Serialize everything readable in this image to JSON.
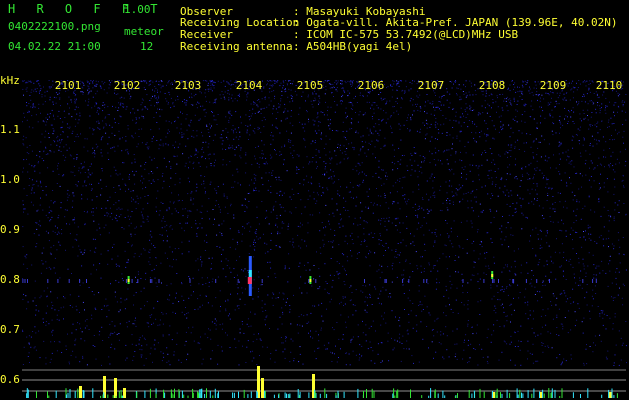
{
  "header": {
    "app_name": "H R O F F T",
    "version": "1.00",
    "filename": "0402222100.png",
    "datetime": "04.02.22 21:00",
    "meteor_label": "meteor",
    "meteor_count": "12",
    "info": [
      {
        "label": "Observer",
        "value": ": Masayuki Kobayashi"
      },
      {
        "label": "Receiving Location",
        "value": ": Ogata-vill. Akita-Pref. JAPAN (139.96E, 40.02N)"
      },
      {
        "label": "Receiver",
        "value": ": ICOM IC-575 53.7492(@LCD)MHz USB"
      },
      {
        "label": "Receiving antenna",
        "value": ": A504HB(yagi 4el)"
      }
    ]
  },
  "chart_data": {
    "type": "heatmap",
    "ylabel": "kHz",
    "x_ticks": [
      "2101",
      "2102",
      "2103",
      "2104",
      "2105",
      "2106",
      "2107",
      "2108",
      "2109",
      "2110"
    ],
    "y_ticks": [
      "1.1",
      "1.0",
      "0.9",
      "0.8",
      "0.7",
      "0.6"
    ],
    "meteor_pings": [
      {
        "x": "2104",
        "y": 0.8
      },
      {
        "x": "2102",
        "y": 0.8
      },
      {
        "x": "2105",
        "y": 0.8
      },
      {
        "x": "2108",
        "y": 0.81
      }
    ],
    "colors": {
      "background": "#000000",
      "noise": "#1a1aa8",
      "signal": "#ffff33",
      "peak": "#ff3366",
      "text": "#ffff33",
      "header": "#33e633"
    }
  }
}
